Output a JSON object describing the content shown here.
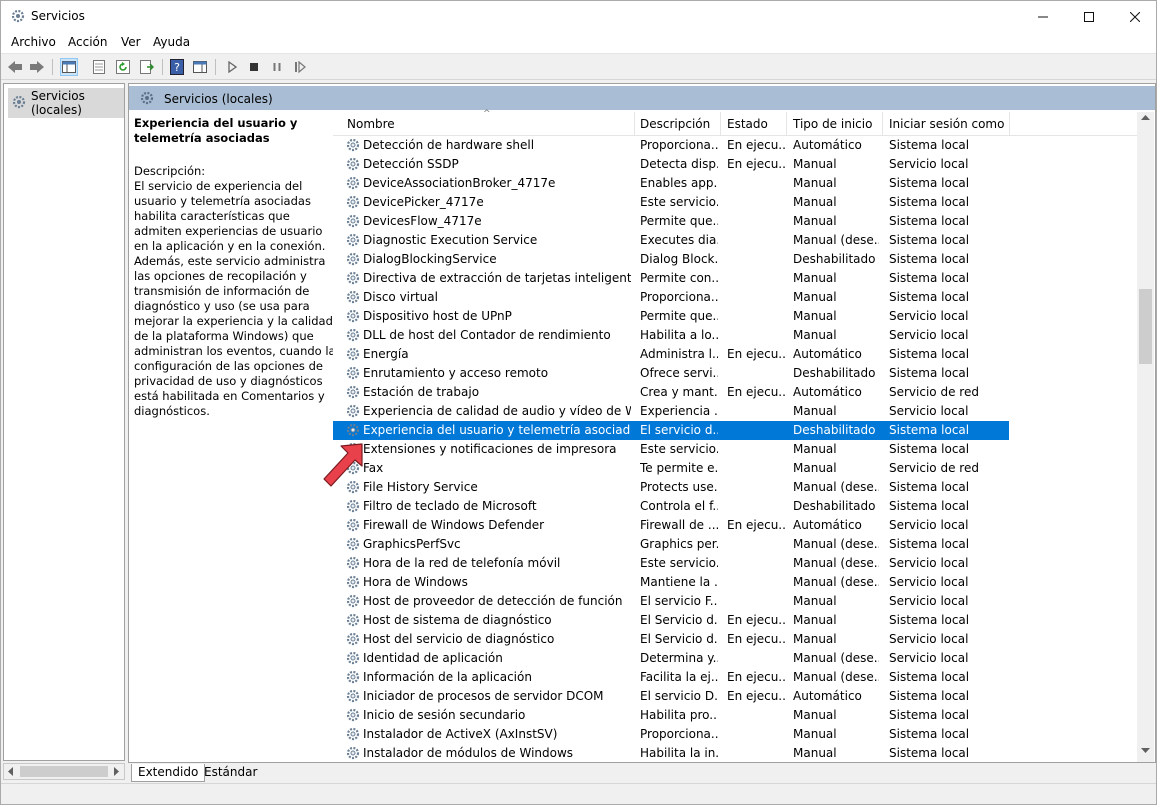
{
  "window": {
    "title": "Servicios"
  },
  "menu": [
    "Archivo",
    "Acción",
    "Ver",
    "Ayuda"
  ],
  "tree": {
    "root_label": "Servicios (locales)"
  },
  "header": {
    "title": "Servicios (locales)"
  },
  "details": {
    "service_title": "Experiencia del usuario y telemetría asociadas",
    "description_label": "Descripción:",
    "description_text": "El servicio de experiencia del usuario y telemetría asociadas habilita características que admiten experiencias de usuario en la aplicación y en la conexión. Además, este servicio administra las opciones de recopilación y transmisión de información de diagnóstico y uso (se usa para mejorar la experiencia y la calidad de la plataforma Windows) que administran los eventos, cuando la configuración de las opciones de privacidad de uso y diagnósticos está habilitada en Comentarios y diagnósticos."
  },
  "columns": {
    "name": "Nombre",
    "description": "Descripción",
    "state": "Estado",
    "startup": "Tipo de inicio",
    "logon": "Iniciar sesión como"
  },
  "services": [
    {
      "name": "Detección de hardware shell",
      "desc": "Proporciona...",
      "state": "En ejecu...",
      "startup": "Automático",
      "logon": "Sistema local"
    },
    {
      "name": "Detección SSDP",
      "desc": "Detecta disp...",
      "state": "En ejecu...",
      "startup": "Manual",
      "logon": "Servicio local"
    },
    {
      "name": "DeviceAssociationBroker_4717e",
      "desc": "Enables app...",
      "state": "",
      "startup": "Manual",
      "logon": "Sistema local"
    },
    {
      "name": "DevicePicker_4717e",
      "desc": "Este servicio...",
      "state": "",
      "startup": "Manual",
      "logon": "Sistema local"
    },
    {
      "name": "DevicesFlow_4717e",
      "desc": "Permite que...",
      "state": "",
      "startup": "Manual",
      "logon": "Sistema local"
    },
    {
      "name": "Diagnostic Execution Service",
      "desc": "Executes dia...",
      "state": "",
      "startup": "Manual (dese...",
      "logon": "Sistema local"
    },
    {
      "name": "DialogBlockingService",
      "desc": "Dialog Block...",
      "state": "",
      "startup": "Deshabilitado",
      "logon": "Sistema local"
    },
    {
      "name": "Directiva de extracción de tarjetas inteligentes",
      "desc": "Permite con...",
      "state": "",
      "startup": "Manual",
      "logon": "Sistema local"
    },
    {
      "name": "Disco virtual",
      "desc": "Proporciona...",
      "state": "",
      "startup": "Manual",
      "logon": "Sistema local"
    },
    {
      "name": "Dispositivo host de UPnP",
      "desc": "Permite que...",
      "state": "",
      "startup": "Manual",
      "logon": "Servicio local"
    },
    {
      "name": "DLL de host del Contador de rendimiento",
      "desc": "Habilita a lo...",
      "state": "",
      "startup": "Manual",
      "logon": "Servicio local"
    },
    {
      "name": "Energía",
      "desc": "Administra l...",
      "state": "En ejecu...",
      "startup": "Automático",
      "logon": "Sistema local"
    },
    {
      "name": "Enrutamiento y acceso remoto",
      "desc": "Ofrece servi...",
      "state": "",
      "startup": "Deshabilitado",
      "logon": "Sistema local"
    },
    {
      "name": "Estación de trabajo",
      "desc": "Crea y mant...",
      "state": "En ejecu...",
      "startup": "Automático",
      "logon": "Servicio de red"
    },
    {
      "name": "Experiencia de calidad de audio y vídeo de Wind...",
      "desc": "Experiencia ...",
      "state": "",
      "startup": "Manual",
      "logon": "Servicio local"
    },
    {
      "name": "Experiencia del usuario y telemetría asociadas",
      "desc": "El servicio d...",
      "state": "",
      "startup": "Deshabilitado",
      "logon": "Sistema local",
      "selected": true
    },
    {
      "name": "Extensiones y notificaciones de impresora",
      "desc": "Este servicio...",
      "state": "",
      "startup": "Manual",
      "logon": "Sistema local"
    },
    {
      "name": "Fax",
      "desc": "Te permite e...",
      "state": "",
      "startup": "Manual",
      "logon": "Servicio de red"
    },
    {
      "name": "File History Service",
      "desc": "Protects use...",
      "state": "",
      "startup": "Manual (dese...",
      "logon": "Sistema local"
    },
    {
      "name": "Filtro de teclado de Microsoft",
      "desc": "Controla el f...",
      "state": "",
      "startup": "Deshabilitado",
      "logon": "Sistema local"
    },
    {
      "name": "Firewall de Windows Defender",
      "desc": "Firewall de ...",
      "state": "En ejecu...",
      "startup": "Automático",
      "logon": "Servicio local"
    },
    {
      "name": "GraphicsPerfSvc",
      "desc": "Graphics per...",
      "state": "",
      "startup": "Manual (dese...",
      "logon": "Sistema local"
    },
    {
      "name": "Hora de la red de telefonía móvil",
      "desc": "Este servicio...",
      "state": "",
      "startup": "Manual (dese...",
      "logon": "Servicio local"
    },
    {
      "name": "Hora de Windows",
      "desc": "Mantiene la ...",
      "state": "",
      "startup": "Manual (dese...",
      "logon": "Servicio local"
    },
    {
      "name": "Host de proveedor de detección de función",
      "desc": "El servicio F...",
      "state": "",
      "startup": "Manual",
      "logon": "Servicio local"
    },
    {
      "name": "Host de sistema de diagnóstico",
      "desc": "El Servicio d...",
      "state": "En ejecu...",
      "startup": "Manual",
      "logon": "Sistema local"
    },
    {
      "name": "Host del servicio de diagnóstico",
      "desc": "El Servicio d...",
      "state": "En ejecu...",
      "startup": "Manual",
      "logon": "Servicio local"
    },
    {
      "name": "Identidad de aplicación",
      "desc": "Determina y...",
      "state": "",
      "startup": "Manual (dese...",
      "logon": "Servicio local"
    },
    {
      "name": "Información de la aplicación",
      "desc": "Facilita la ej...",
      "state": "En ejecu...",
      "startup": "Manual (dese...",
      "logon": "Sistema local"
    },
    {
      "name": "Iniciador de procesos de servidor DCOM",
      "desc": "El servicio D...",
      "state": "En ejecu...",
      "startup": "Automático",
      "logon": "Sistema local"
    },
    {
      "name": "Inicio de sesión secundario",
      "desc": "Habilita pro...",
      "state": "",
      "startup": "Manual",
      "logon": "Sistema local"
    },
    {
      "name": "Instalador de ActiveX (AxInstSV)",
      "desc": "Proporciona...",
      "state": "",
      "startup": "Manual",
      "logon": "Sistema local"
    },
    {
      "name": "Instalador de módulos de Windows",
      "desc": "Habilita la in...",
      "state": "",
      "startup": "Manual",
      "logon": "Sistema local"
    }
  ],
  "tabs": [
    "Extendido",
    "Estándar"
  ],
  "colors": {
    "selection": "#0078d7",
    "header_strip": "#a9bed4",
    "pointer_arrow": "#e8414b"
  }
}
